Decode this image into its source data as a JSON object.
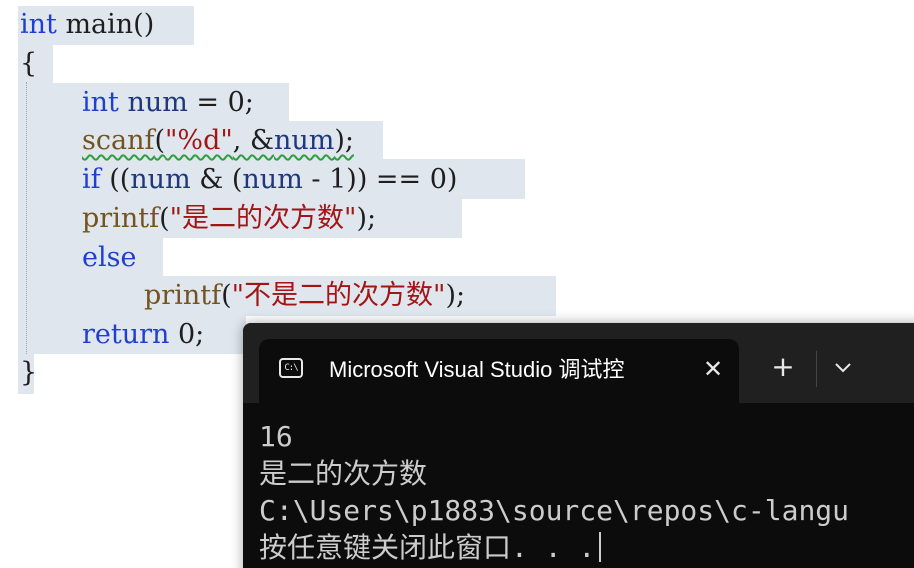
{
  "code": {
    "l1_kw": "int",
    "l1_rest": " main()",
    "l2": "{",
    "l3_kw": "int",
    "l3_id": " num",
    "l3_rest": " = 0;",
    "l4_fn": "scanf",
    "l4_open": "(",
    "l4_str": "\"%d\"",
    "l4_mid": ", &",
    "l4_id": "num",
    "l4_close": ");",
    "l5_kw": "if",
    "l5_a": " ((",
    "l5_id1": "num",
    "l5_b": " & (",
    "l5_id2": "num",
    "l5_c": " - 1)) == 0)",
    "l6_fn": "printf",
    "l6_open": "(",
    "l6_str": "\"是二的次方数\"",
    "l6_close": ");",
    "l7_kw": "else",
    "l8_fn": "printf",
    "l8_open": "(",
    "l8_str": "\"不是二的次方数\"",
    "l8_close": ");",
    "l9_kw": "return",
    "l9_rest": " 0;",
    "l10": "}"
  },
  "terminal": {
    "tab_icon": "C:\\",
    "tab_title": "Microsoft Visual Studio 调试控",
    "close": "✕",
    "new_tab": "+",
    "lines": [
      "16",
      "是二的次方数",
      "C:\\Users\\p1883\\source\\repos\\c-langu",
      "按任意键关闭此窗口. . ."
    ]
  },
  "colors": {
    "keyword": "#1f3fd0",
    "function": "#74531f",
    "string": "#a31515",
    "identifier": "#1f377f",
    "selection": "#dfe6ee",
    "terminal_bg": "#0c0c0c",
    "tabbar_bg": "#202020"
  },
  "icons": [
    "terminal-icon",
    "close-icon",
    "plus-icon",
    "chevron-down-icon"
  ]
}
